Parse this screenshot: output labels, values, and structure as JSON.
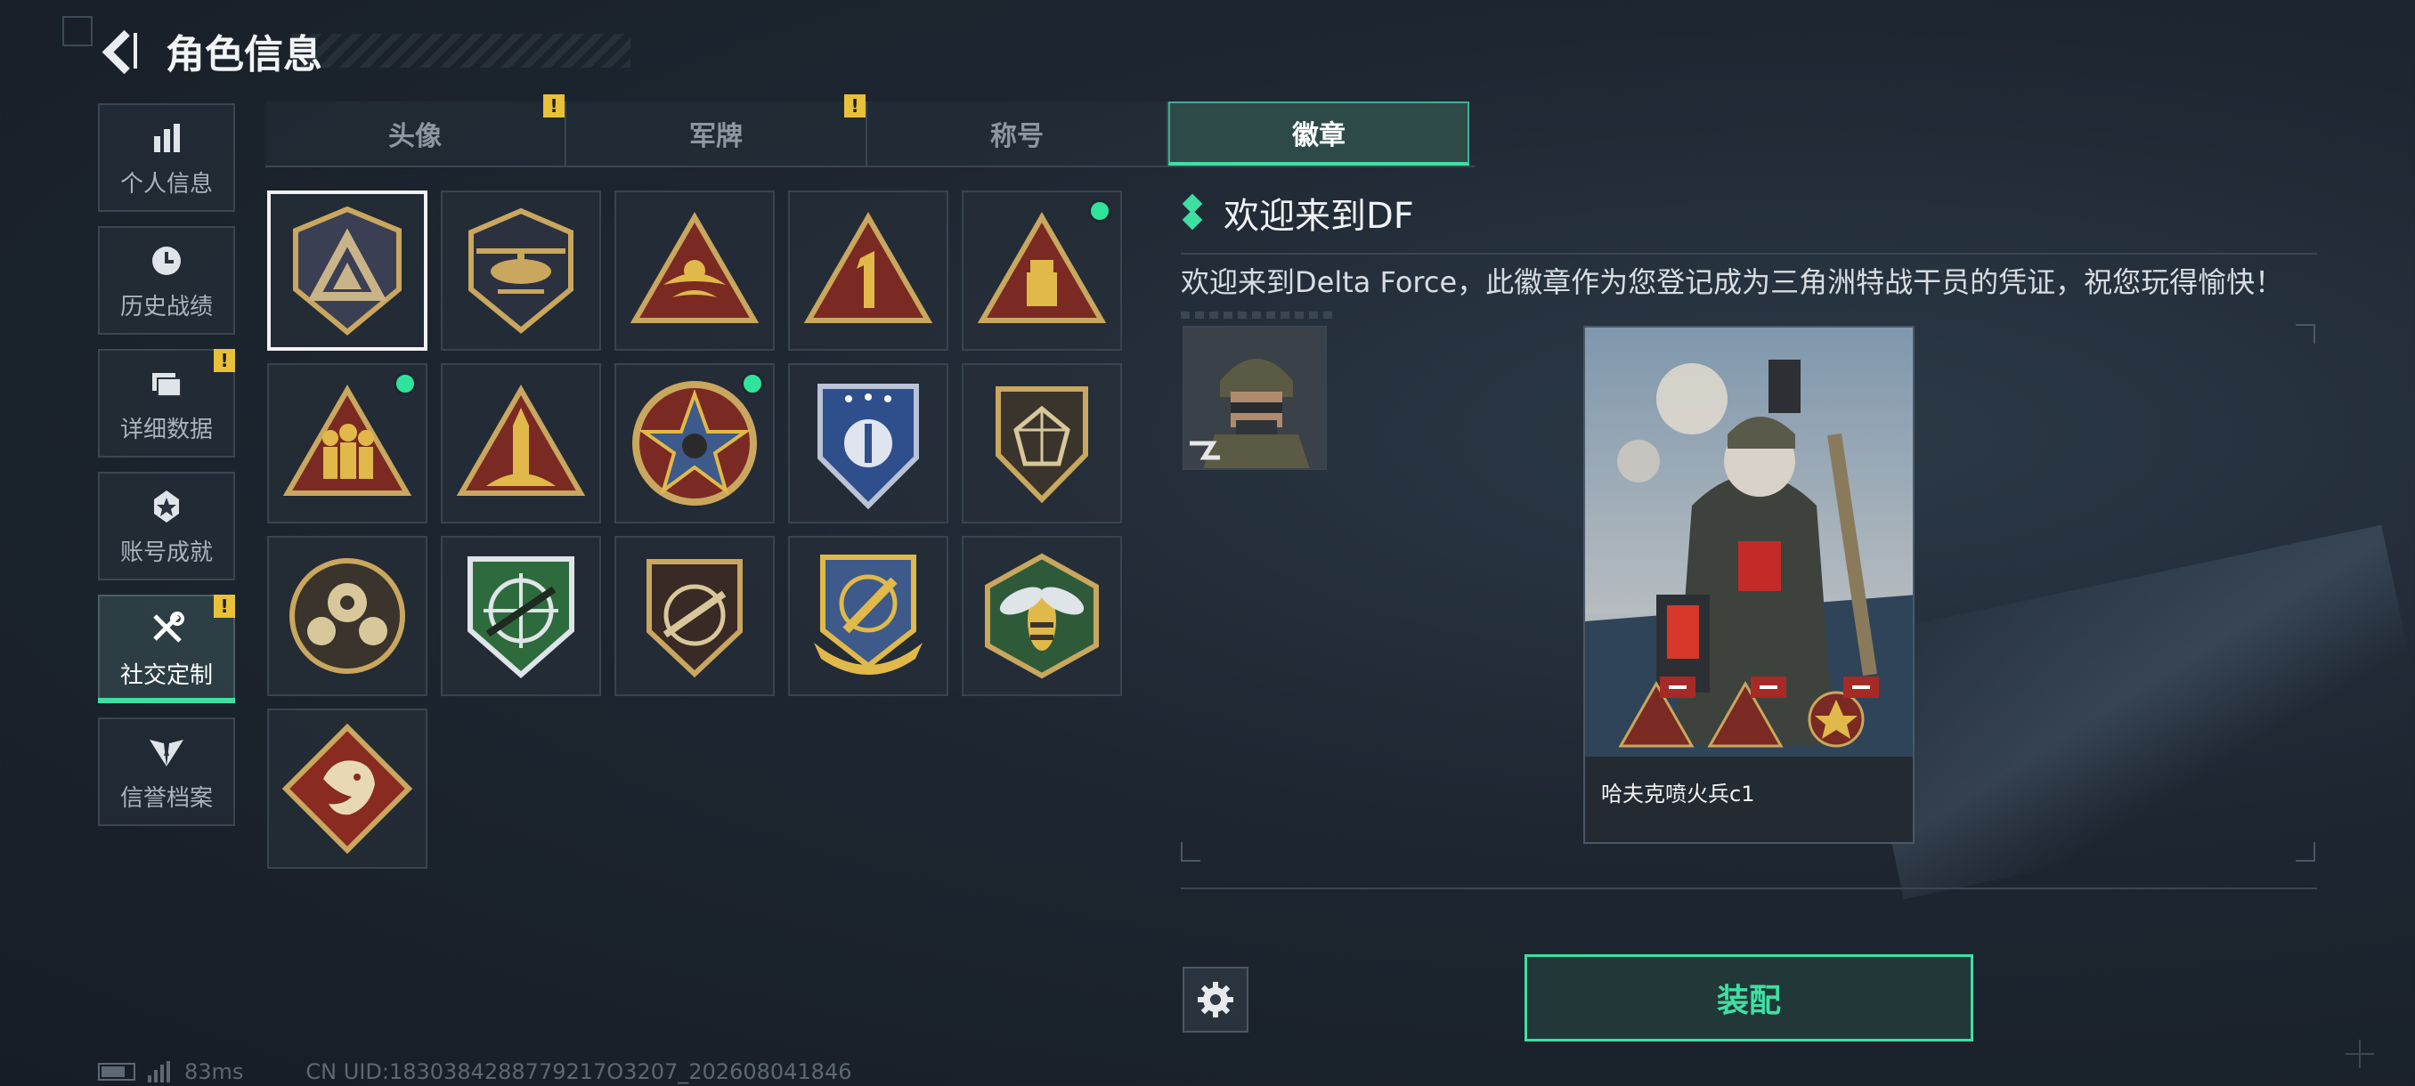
{
  "header": {
    "title": "角色信息"
  },
  "sidebar": {
    "items": [
      {
        "label": "个人信息",
        "icon": "bar-chart-icon",
        "badge": ""
      },
      {
        "label": "历史战绩",
        "icon": "clock-icon",
        "badge": ""
      },
      {
        "label": "详细数据",
        "icon": "folder-icon",
        "badge": "!"
      },
      {
        "label": "账号成就",
        "icon": "star-medal-icon",
        "badge": ""
      },
      {
        "label": "社交定制",
        "icon": "tools-icon",
        "badge": "!",
        "active": true
      },
      {
        "label": "信誉档案",
        "icon": "wings-shield-icon",
        "badge": ""
      }
    ]
  },
  "tabs": [
    {
      "label": "头像",
      "badge": "!"
    },
    {
      "label": "军牌",
      "badge": "!"
    },
    {
      "label": "称号",
      "badge": ""
    },
    {
      "label": "徽章",
      "badge": "",
      "active": true
    }
  ],
  "badges": [
    {
      "icon": "delta-shield-badge-icon",
      "selected": true,
      "new": false
    },
    {
      "icon": "helicopter-badge-icon",
      "selected": false,
      "new": false
    },
    {
      "icon": "wings-triangle-badge-icon",
      "selected": false,
      "new": false
    },
    {
      "icon": "number-one-triangle-badge-icon",
      "selected": false,
      "new": false
    },
    {
      "icon": "usb-triangle-badge-icon",
      "selected": false,
      "new": true
    },
    {
      "icon": "soldiers-triangle-badge-icon",
      "selected": false,
      "new": true
    },
    {
      "icon": "rocket-triangle-badge-icon",
      "selected": false,
      "new": false
    },
    {
      "icon": "star-round-badge-icon",
      "selected": false,
      "new": true
    },
    {
      "icon": "police-shield-badge-icon",
      "selected": false,
      "new": false
    },
    {
      "icon": "gem-shield-badge-icon",
      "selected": false,
      "new": false
    },
    {
      "icon": "crosshair-round-badge-icon",
      "selected": false,
      "new": false
    },
    {
      "icon": "sniper-green-shield-badge-icon",
      "selected": false,
      "new": false
    },
    {
      "icon": "rifle-shield-badge-icon",
      "selected": false,
      "new": false
    },
    {
      "icon": "blade-laurel-badge-icon",
      "selected": false,
      "new": false
    },
    {
      "icon": "hornet-hexagon-badge-icon",
      "selected": false,
      "new": false
    },
    {
      "icon": "dragon-diamond-badge-icon",
      "selected": false,
      "new": false
    }
  ],
  "detail": {
    "title": "欢迎来到DF",
    "description": "欢迎来到Delta Force，此徽章作为您登记成为三角洲特战干员的凭证，祝您玩得愉快！",
    "preview_caption": "哈夫克喷火兵c1"
  },
  "actions": {
    "equip_label": "装配"
  },
  "status": {
    "ping": "83ms",
    "uid": "CN UID:1830384288779217O3207_202608041846"
  },
  "colors": {
    "accent": "#3ee0a2",
    "warning": "#e8c03a",
    "gold": "#c9a75e",
    "maroon": "#7a2a22"
  }
}
